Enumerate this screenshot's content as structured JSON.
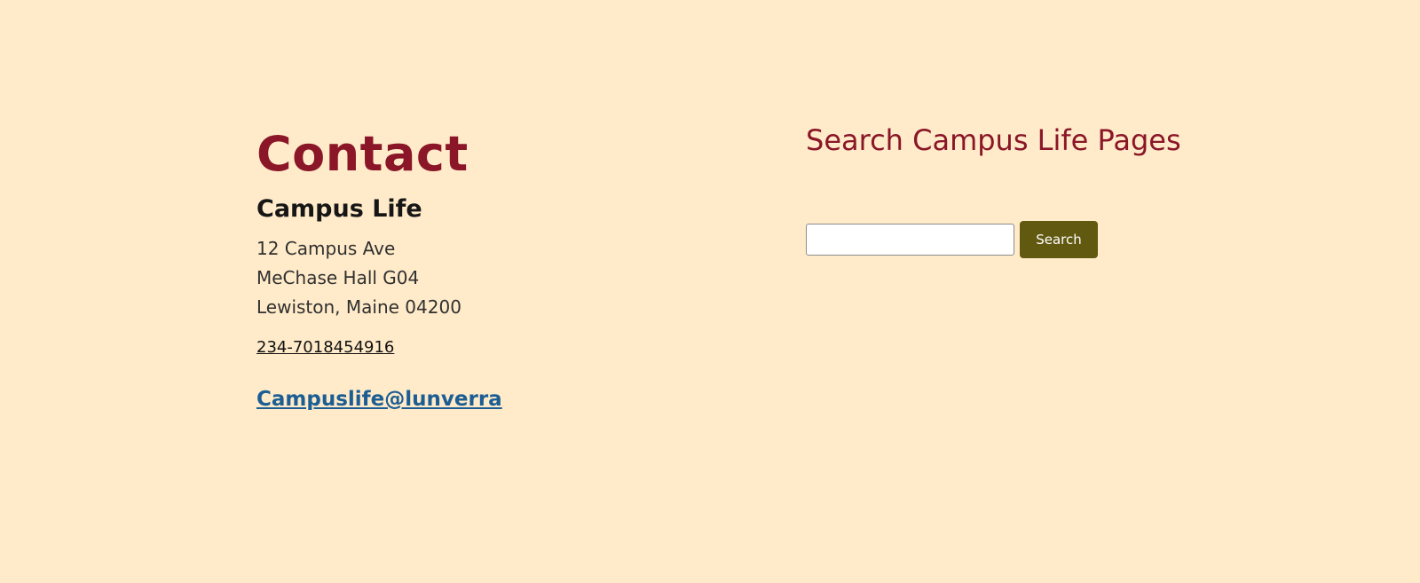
{
  "contact": {
    "title": "Contact",
    "office_name": "Campus Life",
    "address_lines": [
      "12 Campus Ave",
      "MeChase Hall G04",
      "Lewiston, Maine 04200"
    ],
    "phone": "234-7018454916",
    "email": "Campuslife@lunverra"
  },
  "search": {
    "heading": "Search Campus Life Pages",
    "input_value": "",
    "button_label": "Search"
  },
  "colors": {
    "background": "#ffebc9",
    "heading_accent": "#8a1628",
    "link_blue": "#1c5e94",
    "button_olive": "#625911"
  }
}
